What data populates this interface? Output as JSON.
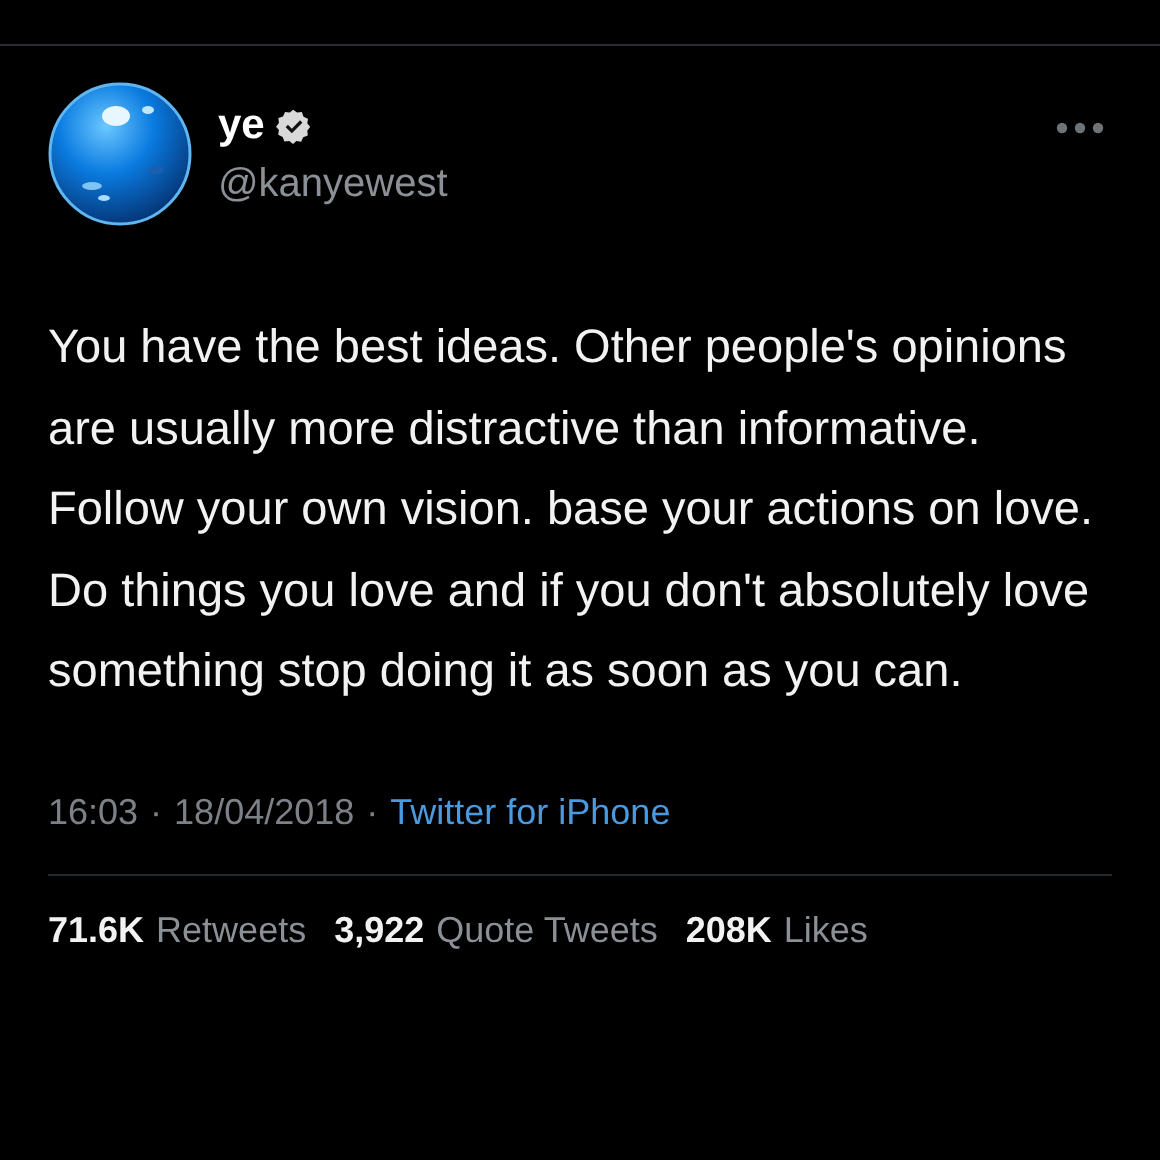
{
  "author": {
    "name": "ye",
    "verified": true,
    "handle": "@kanyewest"
  },
  "tweet": {
    "text": "You have the best ideas. Other people's opinions are usually more  distractive than informative. Follow your own vision. base your actions on love. Do things you love and if you don't absolutely love something stop doing it as soon as you can."
  },
  "meta": {
    "time": "16:03",
    "separator_1": "·",
    "date": "18/04/2018",
    "separator_2": "·",
    "source": "Twitter for iPhone"
  },
  "stats": [
    {
      "count": "71.6K",
      "label": "Retweets"
    },
    {
      "count": "3,922",
      "label": "Quote Tweets"
    },
    {
      "count": "208K",
      "label": "Likes"
    }
  ]
}
